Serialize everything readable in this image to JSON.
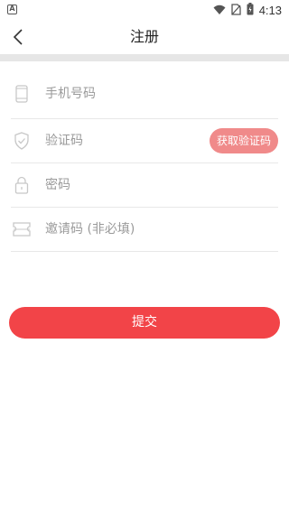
{
  "status_bar": {
    "left_icon": "A",
    "time": "4:13",
    "icons": [
      "wifi-icon",
      "no-sim-icon",
      "battery-charging-icon"
    ]
  },
  "header": {
    "title": "注册",
    "back_icon": "chevron-left-icon"
  },
  "form": {
    "phone": {
      "placeholder": "手机号码",
      "icon": "phone-icon"
    },
    "code": {
      "placeholder": "验证码",
      "icon": "shield-icon",
      "button_label": "获取验证码"
    },
    "password": {
      "placeholder": "密码",
      "icon": "lock-icon"
    },
    "invite": {
      "placeholder": "邀请码 (非必填)",
      "icon": "ticket-icon"
    }
  },
  "submit_label": "提交",
  "colors": {
    "primary": "#f24448",
    "code_button": "#f08a8a",
    "divider": "#e6e6e6",
    "placeholder": "#9a9a9a"
  }
}
